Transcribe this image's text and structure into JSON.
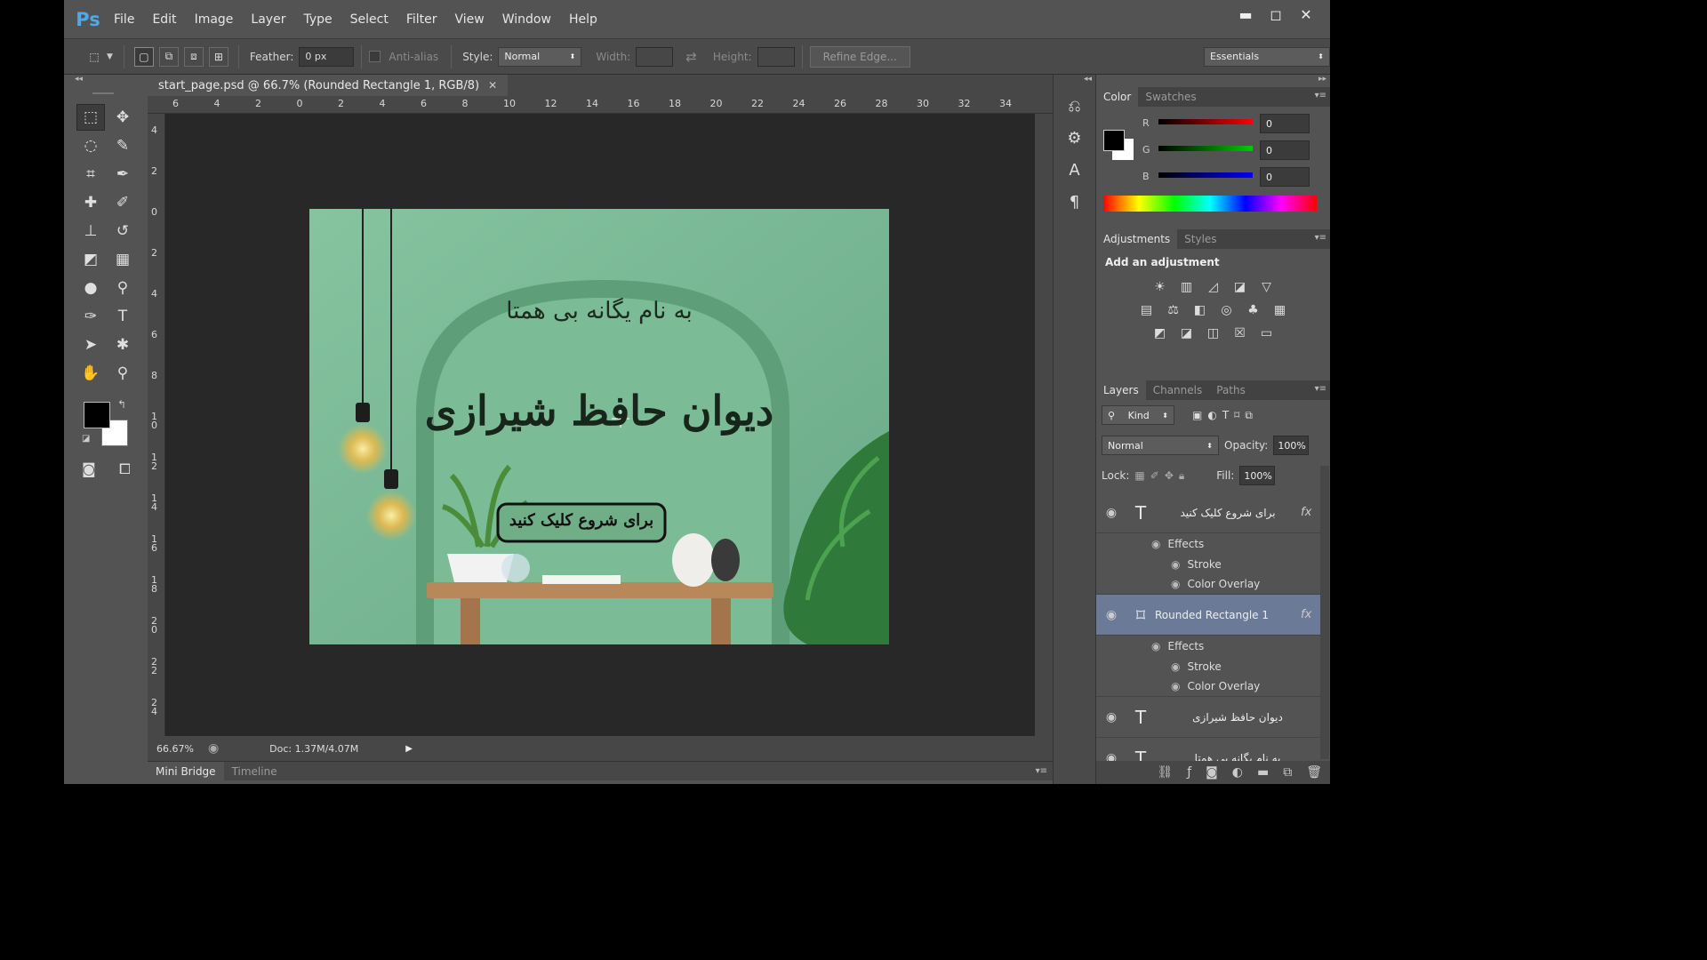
{
  "app": {
    "logo": "Ps"
  },
  "menu": [
    "File",
    "Edit",
    "Image",
    "Layer",
    "Type",
    "Select",
    "Filter",
    "View",
    "Window",
    "Help"
  ],
  "window_controls": {
    "minimize": "▬",
    "restore": "◻",
    "close": "✕"
  },
  "options": {
    "feather_label": "Feather:",
    "feather_value": "0 px",
    "antialias_label": "Anti-alias",
    "style_label": "Style:",
    "style_value": "Normal",
    "width_label": "Width:",
    "height_label": "Height:",
    "refine_edge": "Refine Edge...",
    "workspace": "Essentials"
  },
  "document": {
    "tab_title": "start_page.psd @ 66.7% (Rounded Rectangle 1, RGB/8)",
    "ruler_h": [
      "6",
      "4",
      "2",
      "0",
      "2",
      "4",
      "6",
      "8",
      "10",
      "12",
      "14",
      "16",
      "18",
      "20",
      "22",
      "24",
      "26",
      "28",
      "30",
      "32",
      "34"
    ],
    "ruler_v": [
      "4",
      "2",
      "0",
      "2",
      "4",
      "6",
      "8",
      "1 0",
      "1 2",
      "1 4",
      "1 6",
      "1 8",
      "2 0",
      "2 2",
      "2 4"
    ],
    "canvas_text": {
      "small": "به نام یگانه بی همتا",
      "title": "دیوان حافظ شیرازی",
      "button": "برای شروع کلیک کنید"
    }
  },
  "status": {
    "zoom": "66.67%",
    "doc": "Doc: 1.37M/4.07M"
  },
  "bottom_tabs": [
    "Mini Bridge",
    "Timeline"
  ],
  "color_panel": {
    "tabs": [
      "Color",
      "Swatches"
    ],
    "r_label": "R",
    "g_label": "G",
    "b_label": "B",
    "r": "0",
    "g": "0",
    "b": "0"
  },
  "adjustments": {
    "tabs": [
      "Adjustments",
      "Styles"
    ],
    "title": "Add an adjustment"
  },
  "layers_panel": {
    "tabs": [
      "Layers",
      "Channels",
      "Paths"
    ],
    "kind": "Kind",
    "blend_mode": "Normal",
    "opacity_label": "Opacity:",
    "opacity": "100%",
    "lock_label": "Lock:",
    "fill_label": "Fill:",
    "fill": "100%",
    "layers": [
      {
        "name": "برای شروع کلیک کنید",
        "type": "T",
        "fx": "fx",
        "effects_label": "Effects",
        "effects": [
          "Stroke",
          "Color Overlay"
        ]
      },
      {
        "name": "Rounded Rectangle 1",
        "type": "shape",
        "fx": "fx",
        "effects_label": "Effects",
        "effects": [
          "Stroke",
          "Color Overlay"
        ]
      },
      {
        "name": "دیوان حافظ شیرازی",
        "type": "T"
      },
      {
        "name": "به نام یگانه بی همتا",
        "type": "T"
      }
    ]
  },
  "colors": {
    "accent_selected": "#6b7a96",
    "ps_blue": "#4fa8e8",
    "canvas_green": "#7cb996"
  }
}
